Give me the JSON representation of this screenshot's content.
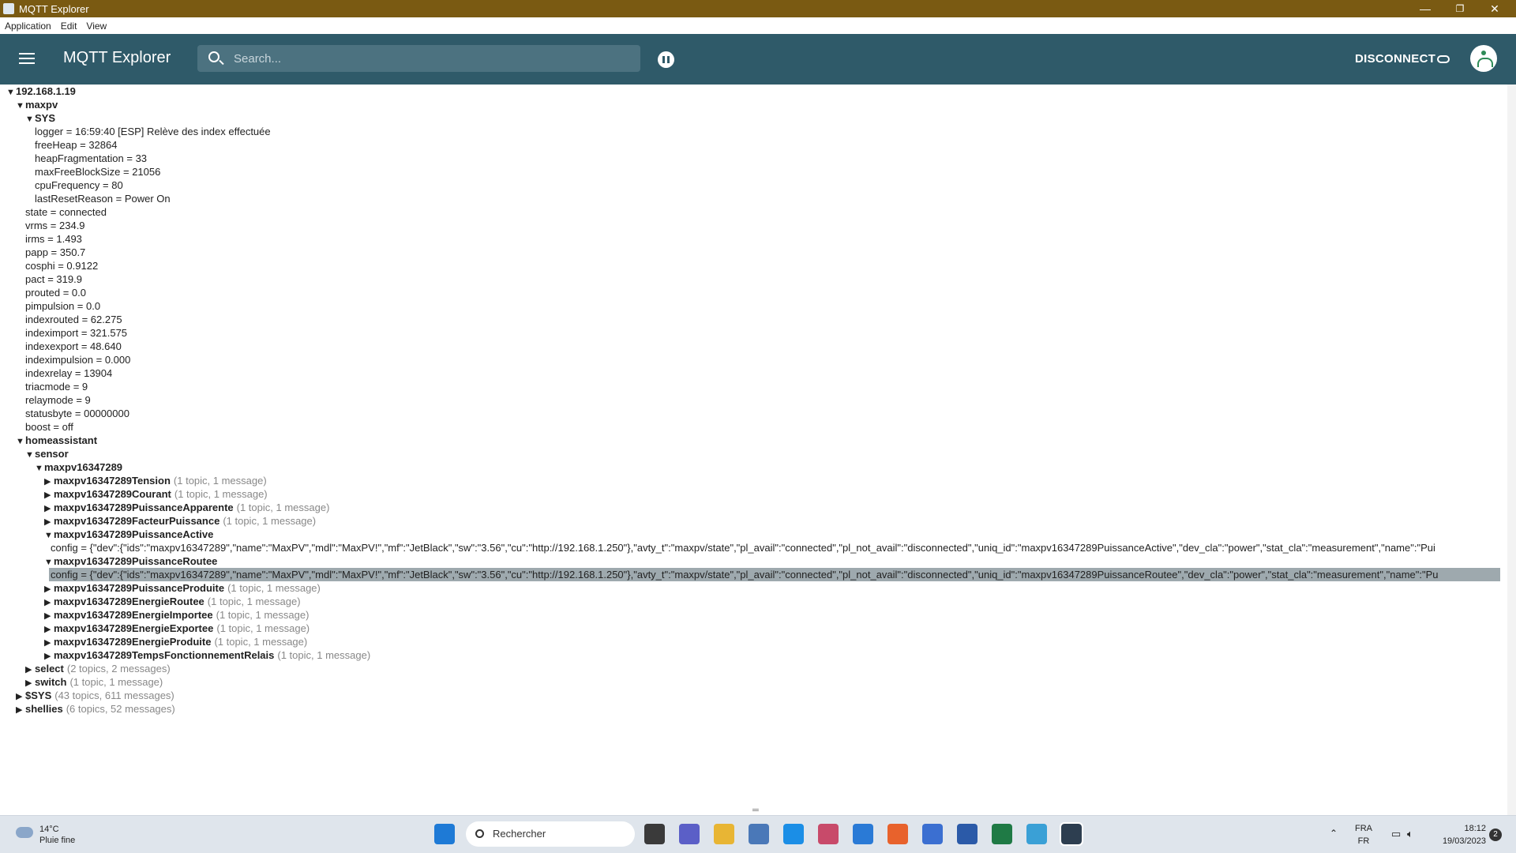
{
  "window": {
    "title": "MQTT Explorer",
    "minimize": "—",
    "restore": "❐",
    "close": "✕"
  },
  "menu": [
    "Application",
    "Edit",
    "View"
  ],
  "appbar": {
    "brand": "MQTT Explorer",
    "search_placeholder": "Search...",
    "disconnect_label": "DISCONNECT"
  },
  "tree": [
    {
      "level": 0,
      "open": true,
      "name": "192.168.1.19"
    },
    {
      "level": 1,
      "open": true,
      "name": "maxpv"
    },
    {
      "level": 2,
      "open": true,
      "name": "SYS"
    },
    {
      "level": 3,
      "name": "logger",
      "value": "16:59:40 [ESP] Relève des index effectuée"
    },
    {
      "level": 3,
      "name": "freeHeap",
      "value": "32864"
    },
    {
      "level": 3,
      "name": "heapFragmentation",
      "value": "33"
    },
    {
      "level": 3,
      "name": "maxFreeBlockSize",
      "value": "21056"
    },
    {
      "level": 3,
      "name": "cpuFrequency",
      "value": "80"
    },
    {
      "level": 3,
      "name": "lastResetReason",
      "value": "Power On"
    },
    {
      "level": 2,
      "name": "state",
      "value": "connected"
    },
    {
      "level": 2,
      "name": "vrms",
      "value": "234.9"
    },
    {
      "level": 2,
      "name": "irms",
      "value": "1.493"
    },
    {
      "level": 2,
      "name": "papp",
      "value": "350.7"
    },
    {
      "level": 2,
      "name": "cosphi",
      "value": "0.9122"
    },
    {
      "level": 2,
      "name": "pact",
      "value": "319.9"
    },
    {
      "level": 2,
      "name": "prouted",
      "value": "0.0"
    },
    {
      "level": 2,
      "name": "pimpulsion",
      "value": "0.0"
    },
    {
      "level": 2,
      "name": "indexrouted",
      "value": "62.275"
    },
    {
      "level": 2,
      "name": "indeximport",
      "value": "321.575"
    },
    {
      "level": 2,
      "name": "indexexport",
      "value": "48.640"
    },
    {
      "level": 2,
      "name": "indeximpulsion",
      "value": "0.000"
    },
    {
      "level": 2,
      "name": "indexrelay",
      "value": "13904"
    },
    {
      "level": 2,
      "name": "triacmode",
      "value": "9"
    },
    {
      "level": 2,
      "name": "relaymode",
      "value": "9"
    },
    {
      "level": 2,
      "name": "statusbyte",
      "value": "00000000"
    },
    {
      "level": 2,
      "name": "boost",
      "value": "off"
    },
    {
      "level": 1,
      "open": true,
      "name": "homeassistant"
    },
    {
      "level": 2,
      "open": true,
      "name": "sensor"
    },
    {
      "level": 3,
      "open": true,
      "name": "maxpv16347289"
    },
    {
      "level": 4,
      "open": false,
      "name": "maxpv16347289Tension",
      "suffix": "(1 topic, 1 message)"
    },
    {
      "level": 4,
      "open": false,
      "name": "maxpv16347289Courant",
      "suffix": "(1 topic, 1 message)"
    },
    {
      "level": 4,
      "open": false,
      "name": "maxpv16347289PuissanceApparente",
      "suffix": "(1 topic, 1 message)"
    },
    {
      "level": 4,
      "open": false,
      "name": "maxpv16347289FacteurPuissance",
      "suffix": "(1 topic, 1 message)"
    },
    {
      "level": 4,
      "open": true,
      "name": "maxpv16347289PuissanceActive"
    },
    {
      "level": 5,
      "name": "config",
      "value": "{\"dev\":{\"ids\":\"maxpv16347289\",\"name\":\"MaxPV\",\"mdl\":\"MaxPV!\",\"mf\":\"JetBlack\",\"sw\":\"3.56\",\"cu\":\"http://192.168.1.250\"},\"avty_t\":\"maxpv/state\",\"pl_avail\":\"connected\",\"pl_not_avail\":\"disconnected\",\"uniq_id\":\"maxpv16347289PuissanceActive\",\"dev_cla\":\"power\",\"stat_cla\":\"measurement\",\"name\":\"Pui"
    },
    {
      "level": 4,
      "open": true,
      "name": "maxpv16347289PuissanceRoutee"
    },
    {
      "level": 5,
      "name": "config",
      "selected": true,
      "value": "{\"dev\":{\"ids\":\"maxpv16347289\",\"name\":\"MaxPV\",\"mdl\":\"MaxPV!\",\"mf\":\"JetBlack\",\"sw\":\"3.56\",\"cu\":\"http://192.168.1.250\"},\"avty_t\":\"maxpv/state\",\"pl_avail\":\"connected\",\"pl_not_avail\":\"disconnected\",\"uniq_id\":\"maxpv16347289PuissanceRoutee\",\"dev_cla\":\"power\",\"stat_cla\":\"measurement\",\"name\":\"Pu"
    },
    {
      "level": 4,
      "open": false,
      "name": "maxpv16347289PuissanceProduite",
      "suffix": "(1 topic, 1 message)"
    },
    {
      "level": 4,
      "open": false,
      "name": "maxpv16347289EnergieRoutee",
      "suffix": "(1 topic, 1 message)"
    },
    {
      "level": 4,
      "open": false,
      "name": "maxpv16347289EnergieImportee",
      "suffix": "(1 topic, 1 message)"
    },
    {
      "level": 4,
      "open": false,
      "name": "maxpv16347289EnergieExportee",
      "suffix": "(1 topic, 1 message)"
    },
    {
      "level": 4,
      "open": false,
      "name": "maxpv16347289EnergieProduite",
      "suffix": "(1 topic, 1 message)"
    },
    {
      "level": 4,
      "open": false,
      "name": "maxpv16347289TempsFonctionnementRelais",
      "suffix": "(1 topic, 1 message)"
    },
    {
      "level": 2,
      "open": false,
      "name": "select",
      "suffix": "(2 topics, 2 messages)"
    },
    {
      "level": 2,
      "open": false,
      "name": "switch",
      "suffix": "(1 topic, 1 message)"
    },
    {
      "level": 1,
      "open": false,
      "name": "$SYS",
      "suffix": "(43 topics, 611 messages)"
    },
    {
      "level": 1,
      "open": false,
      "name": "shellies",
      "suffix": "(6 topics, 52 messages)"
    }
  ],
  "taskbar": {
    "weather_temp": "14°C",
    "weather_desc": "Pluie fine",
    "search_label": "Rechercher",
    "lang_top": "FRA",
    "lang_bottom": "FR",
    "time": "18:12",
    "date": "19/03/2023",
    "notif_count": "2",
    "apps": [
      "start-icon",
      "task-view-icon",
      "chat-icon",
      "file-explorer-icon",
      "network-app-icon",
      "edge-icon",
      "gift-app-icon",
      "mail-icon",
      "firefox-icon",
      "notepad-icon",
      "store-icon",
      "excel-icon",
      "fan-app-icon",
      "mqtt-explorer-icon"
    ]
  }
}
